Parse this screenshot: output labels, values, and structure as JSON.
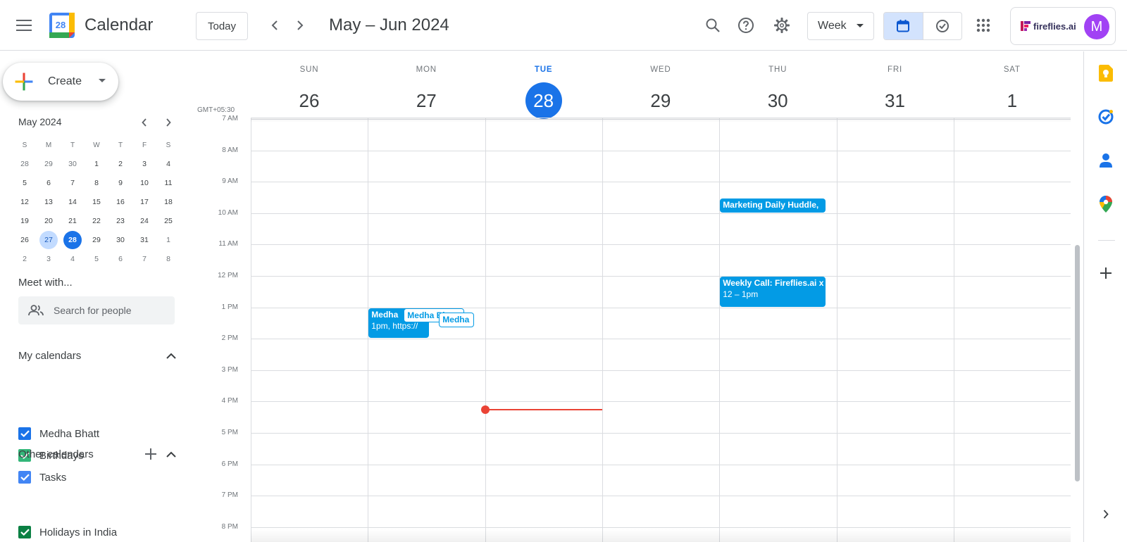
{
  "app": {
    "title": "Calendar",
    "logo_day": "28",
    "colors": {
      "primary": "#1a73e8",
      "event": "#039be5",
      "now_line": "#ea4335",
      "selected_day": "#c2dbff"
    }
  },
  "header": {
    "menu_icon": "hamburger-menu-icon",
    "today_label": "Today",
    "date_range": "May – Jun 2024",
    "view_label": "Week",
    "account_brand": "fireflies.ai",
    "avatar_letter": "M",
    "icons": [
      "search-icon",
      "help-icon",
      "settings-icon",
      "calendar-view-icon",
      "tasks-view-icon",
      "apps-grid-icon"
    ]
  },
  "sidebar": {
    "create_label": "Create",
    "mini_calendar": {
      "title": "May 2024",
      "weekdays": [
        "S",
        "M",
        "T",
        "W",
        "T",
        "F",
        "S"
      ],
      "weeks": [
        [
          "28",
          "29",
          "30",
          "1",
          "2",
          "3",
          "4"
        ],
        [
          "5",
          "6",
          "7",
          "8",
          "9",
          "10",
          "11"
        ],
        [
          "12",
          "13",
          "14",
          "15",
          "16",
          "17",
          "18"
        ],
        [
          "19",
          "20",
          "21",
          "22",
          "23",
          "24",
          "25"
        ],
        [
          "26",
          "27",
          "28",
          "29",
          "30",
          "31",
          "1"
        ],
        [
          "2",
          "3",
          "4",
          "5",
          "6",
          "7",
          "8"
        ]
      ],
      "selected_day": "27",
      "today": "28"
    },
    "meet_with_title": "Meet with...",
    "search_people_placeholder": "Search for people",
    "my_calendars_title": "My calendars",
    "my_calendars": [
      {
        "label": "Medha Bhatt",
        "color": "#1a73e8"
      },
      {
        "label": "Birthdays",
        "color": "#33b679"
      },
      {
        "label": "Tasks",
        "color": "#4285f4"
      }
    ],
    "other_calendars_title": "Other calendars",
    "other_calendars": [
      {
        "label": "Holidays in India",
        "color": "#0b8043"
      }
    ]
  },
  "week": {
    "timezone": "GMT+05:30",
    "days": [
      {
        "dow": "SUN",
        "num": "26",
        "today": false
      },
      {
        "dow": "MON",
        "num": "27",
        "today": false
      },
      {
        "dow": "TUE",
        "num": "28",
        "today": true
      },
      {
        "dow": "WED",
        "num": "29",
        "today": false
      },
      {
        "dow": "THU",
        "num": "30",
        "today": false
      },
      {
        "dow": "FRI",
        "num": "31",
        "today": false
      },
      {
        "dow": "SAT",
        "num": "1",
        "today": false
      }
    ],
    "hours": [
      "7 AM",
      "8 AM",
      "9 AM",
      "10 AM",
      "11 AM",
      "12 PM",
      "1 PM",
      "2 PM",
      "3 PM",
      "4 PM",
      "5 PM",
      "6 PM",
      "7 PM",
      "8 PM"
    ],
    "events": [
      {
        "title": "Marketing Daily Huddle,",
        "subtitle": "",
        "day": "THU",
        "start": 9.5,
        "end": 10,
        "style": "filled"
      },
      {
        "title": "Weekly Call: Fireflies.ai x",
        "subtitle": "12 – 1pm",
        "day": "THU",
        "start": 12,
        "end": 13,
        "style": "filled"
      },
      {
        "title": "Medha",
        "subtitle": "1pm, https://",
        "day": "MON",
        "start": 13,
        "end": 14,
        "style": "filled"
      },
      {
        "title": "Medha Bh",
        "subtitle": "",
        "day": "MON",
        "start": 13,
        "end": 13.5,
        "style": "outline"
      },
      {
        "title": "Medha",
        "subtitle": "",
        "day": "MON",
        "start": 13.15,
        "end": 13.65,
        "style": "outline"
      }
    ],
    "now_time": 16.27
  },
  "right_panel": {
    "icons": [
      "keep-icon",
      "tasks-icon",
      "contacts-icon",
      "maps-icon",
      "add-addon-icon",
      "expand-panel-icon"
    ]
  }
}
